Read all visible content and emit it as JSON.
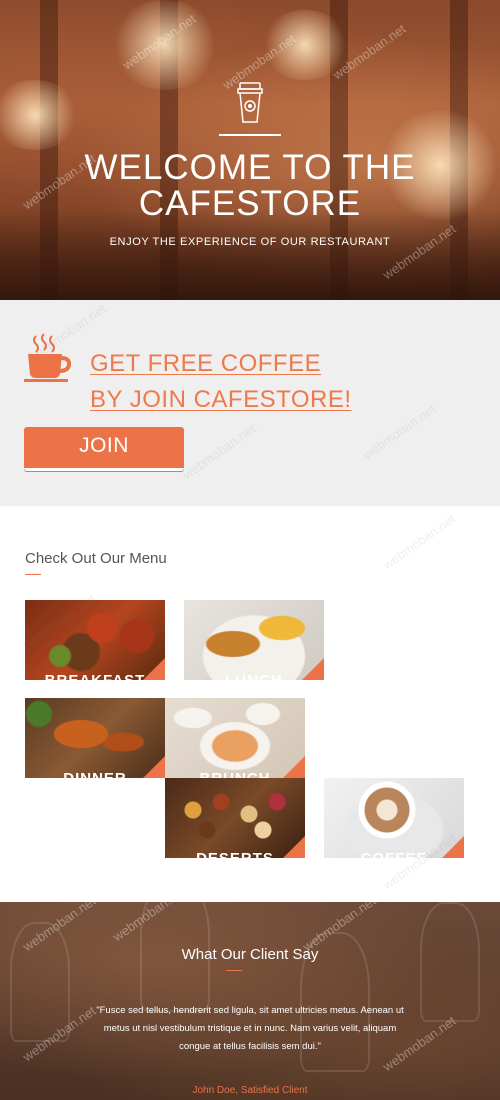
{
  "hero": {
    "title_line1": "WELCOME TO THE",
    "title_line2": "CAFESTORE",
    "subtitle": "ENJOY THE EXPERIENCE OF OUR RESTAURANT",
    "icon": "coffee-cup-icon"
  },
  "offer": {
    "icon": "steaming-cup-icon",
    "line1": "GET FREE COFFEE",
    "line2": "BY JOIN CAFESTORE!",
    "join_label": "JOIN"
  },
  "menu": {
    "title": "Check Out Our Menu",
    "items": [
      {
        "label": "BREAKFAST"
      },
      {
        "label": "LUNCH"
      },
      {
        "label": "DINNER"
      },
      {
        "label": "BRUNCH"
      },
      {
        "label": "DESERTS"
      },
      {
        "label": "COFFEE"
      }
    ]
  },
  "testimonial": {
    "title": "What Our Client Say",
    "quote": "\"Fusce sed tellus, hendrerit sed ligula, sit amet ultricies metus. Aenean ut metus ut nisl vestibulum tristique et in nunc. Nam varius velit, aliquam congue at tellus facilisis sem dui.\"",
    "author": "John Doe, Satisfied Client"
  },
  "watermark": "webmoban.net",
  "colors": {
    "accent": "#ec7347",
    "offer_bg": "#efefef",
    "menu_title": "#555555"
  }
}
